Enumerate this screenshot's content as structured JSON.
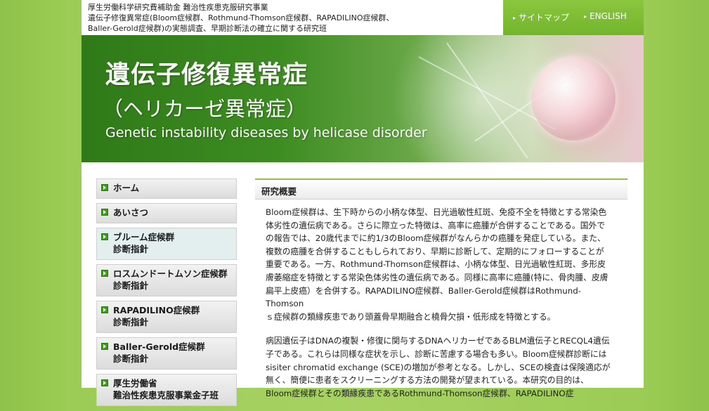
{
  "header": {
    "subtitle_lines": [
      "厚生労働科学研究費補助金 難治性疾患克服研究事業",
      "遺伝子修復異常症(Bloom症候群、Rothmund-Thomson症候群、RAPADILINO症候群、",
      "Baller-Gerold症候群)の実態調査、早期診断法の確立に関する研究班"
    ],
    "links": {
      "sitemap": "サイトマップ",
      "english": "ENGLISH"
    }
  },
  "banner": {
    "title_ja": "遺伝子修復異常症",
    "subtitle_ja": "（ヘリカーゼ異常症）",
    "title_en": "Genetic instability diseases by helicase disorder"
  },
  "sidebar": {
    "items": [
      {
        "line1": "ホーム",
        "line2": ""
      },
      {
        "line1": "あいさつ",
        "line2": ""
      },
      {
        "line1": "ブルーム症候群",
        "line2": "診断指針"
      },
      {
        "line1": "ロスムンドートムソン症候群",
        "line2": "診断指針"
      },
      {
        "line1": "RAPADILINO症候群",
        "line2": "診断指針"
      },
      {
        "line1": "Baller-Gerold症候群",
        "line2": "診断指針"
      },
      {
        "line1": "厚生労働省",
        "line2": "難治性疾患克服事業金子班"
      }
    ]
  },
  "main": {
    "section_title": "研究概要",
    "paragraph1": [
      "Bloom症候群は、生下時からの小柄な体型、日光過敏性紅斑、免疫不全を特徴とする常染色",
      "体劣性の遺伝病である。さらに際立った特徴は、高率に癌腫が合併することである。国外で",
      "の報告では、20歳代までに約1/3のBloom症候群がなんらかの癌腫を発症している。また、",
      "複数の癌腫を合併することもしられており、早期に診断して、定期的にフォローすることが",
      "重要である。一方、Rothmund-Thomson症候群は、小柄な体型、日光過敏性紅斑、多形皮",
      "膚萎縮症を特徴とする常染色体劣性の遺伝病である。同様に高率に癌腫(特に、骨肉腫、皮膚",
      "扁平上皮癌）を合併する。RAPADILINO症候群、Baller-Gerold症候群はRothmund-Thomson",
      "ｓ症候群の類縁疾患であり頭蓋骨早期融合と橈骨欠損・低形成を特徴とする。"
    ],
    "paragraph2": [
      "病因遺伝子はDNAの複製・修復に関与するDNAヘリカーゼであるBLM遺伝子とRECQL4遺伝",
      "子である。これらは同様な症状を示し、診断に苦慮する場合も多い。Bloom症候群診断には",
      "sisiter chromatid exchange (SCE)の増加が参考となる。しかし、SCEの検査は保険適応が",
      "無く、簡便に患者をスクリーニングする方法の開発が望まれている。本研究の目的は、",
      "Bloom症候群とその類縁疾患であるRothmund-Thomson症候群、RAPADILINO症"
    ]
  },
  "colors": {
    "accent": "#8fc24a",
    "banner_green": "#3d8c22",
    "nav_green": "#72b52c"
  }
}
